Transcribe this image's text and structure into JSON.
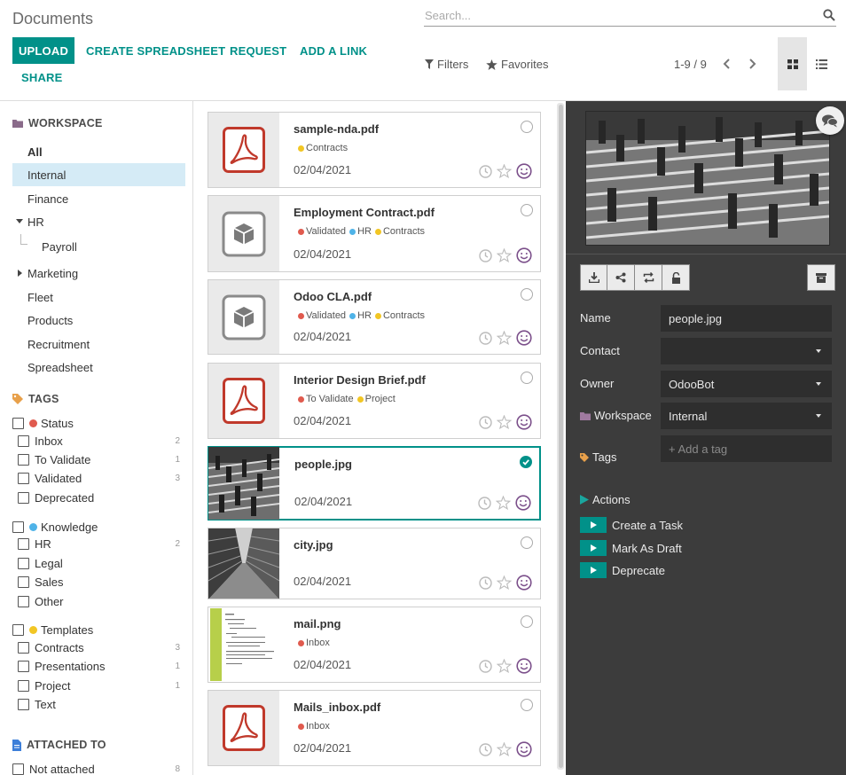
{
  "control_panel": {
    "title": "Documents",
    "buttons": {
      "upload": "UPLOAD",
      "create_spreadsheet": "CREATE SPREADSHEET",
      "request": "REQUEST",
      "add_link": "ADD A LINK",
      "share": "SHARE"
    },
    "search": {
      "placeholder": "Search..."
    },
    "filters_label": "Filters",
    "favorites_label": "Favorites",
    "pager": "1-9 / 9",
    "views": [
      "kanban-icon",
      "list-icon"
    ],
    "accent_color": "#019189"
  },
  "sidebar": {
    "workspace_header": "WORKSPACE",
    "workspaces": [
      {
        "label": "All",
        "selected": false
      },
      {
        "label": "Internal",
        "selected": true
      },
      {
        "label": "Finance",
        "selected": false
      },
      {
        "label": "HR",
        "selected": false
      },
      {
        "label": "Payroll",
        "selected": false
      },
      {
        "label": "Marketing",
        "selected": false
      },
      {
        "label": "Fleet",
        "selected": false
      },
      {
        "label": "Products",
        "selected": false
      },
      {
        "label": "Recruitment",
        "selected": false
      },
      {
        "label": "Spreadsheet",
        "selected": false
      }
    ],
    "tags_header": "TAGS",
    "tag_groups": [
      {
        "label": "Status",
        "color": "#e05a4e",
        "tags": [
          {
            "label": "Inbox",
            "count": "2"
          },
          {
            "label": "To Validate",
            "count": "1"
          },
          {
            "label": "Validated",
            "count": "3"
          },
          {
            "label": "Deprecated",
            "count": ""
          }
        ]
      },
      {
        "label": "Knowledge",
        "color": "#4fb3e8",
        "tags": [
          {
            "label": "HR",
            "count": "2"
          },
          {
            "label": "Legal",
            "count": ""
          },
          {
            "label": "Sales",
            "count": ""
          },
          {
            "label": "Other",
            "count": ""
          }
        ]
      },
      {
        "label": "Templates",
        "color": "#f2c624",
        "tags": [
          {
            "label": "Contracts",
            "count": "3"
          },
          {
            "label": "Presentations",
            "count": "1"
          },
          {
            "label": "Project",
            "count": "1"
          },
          {
            "label": "Text",
            "count": ""
          }
        ]
      }
    ],
    "attached_header": "ATTACHED TO",
    "attached_items": [
      {
        "label": "Not attached",
        "count": "8"
      }
    ]
  },
  "documents": [
    {
      "name": "sample-nda.pdf",
      "date": "02/04/2021",
      "thumb": "pdf-icon",
      "selected": false,
      "tags": [
        {
          "label": "Contracts",
          "color": "#f2c624"
        }
      ]
    },
    {
      "name": "Employment Contract.pdf",
      "date": "02/04/2021",
      "thumb": "box-icon",
      "selected": false,
      "tags": [
        {
          "label": "Validated",
          "color": "#e05a4e"
        },
        {
          "label": "HR",
          "color": "#4fb3e8"
        },
        {
          "label": "Contracts",
          "color": "#f2c624"
        }
      ]
    },
    {
      "name": "Odoo CLA.pdf",
      "date": "02/04/2021",
      "thumb": "box-icon",
      "selected": false,
      "tags": [
        {
          "label": "Validated",
          "color": "#e05a4e"
        },
        {
          "label": "HR",
          "color": "#4fb3e8"
        },
        {
          "label": "Contracts",
          "color": "#f2c624"
        }
      ]
    },
    {
      "name": "Interior Design Brief.pdf",
      "date": "02/04/2021",
      "thumb": "pdf-icon",
      "selected": false,
      "tags": [
        {
          "label": "To Validate",
          "color": "#e05a4e"
        },
        {
          "label": "Project",
          "color": "#f2c624"
        }
      ]
    },
    {
      "name": "people.jpg",
      "date": "02/04/2021",
      "thumb": "photo-stairs",
      "selected": true,
      "tags": []
    },
    {
      "name": "city.jpg",
      "date": "02/04/2021",
      "thumb": "photo-city",
      "selected": false,
      "tags": []
    },
    {
      "name": "mail.png",
      "date": "02/04/2021",
      "thumb": "screenshot-mail",
      "selected": false,
      "tags": [
        {
          "label": "Inbox",
          "color": "#e05a4e"
        }
      ]
    },
    {
      "name": "Mails_inbox.pdf",
      "date": "02/04/2021",
      "thumb": "pdf-icon",
      "selected": false,
      "tags": [
        {
          "label": "Inbox",
          "color": "#e05a4e"
        }
      ]
    }
  ],
  "inspector": {
    "fields": {
      "name_label": "Name",
      "name_value": "people.jpg",
      "contact_label": "Contact",
      "contact_value": "",
      "owner_label": "Owner",
      "owner_value": "OdooBot",
      "workspace_label": "Workspace",
      "workspace_value": "Internal",
      "tags_label": "Tags",
      "tags_placeholder": "+ Add a tag"
    },
    "actions_label": "Actions",
    "actions": [
      "Create a Task",
      "Mark As Draft",
      "Deprecate"
    ],
    "tool_icons": [
      "download-icon",
      "share-icon",
      "replace-icon",
      "lock-icon",
      "archive-icon"
    ]
  }
}
